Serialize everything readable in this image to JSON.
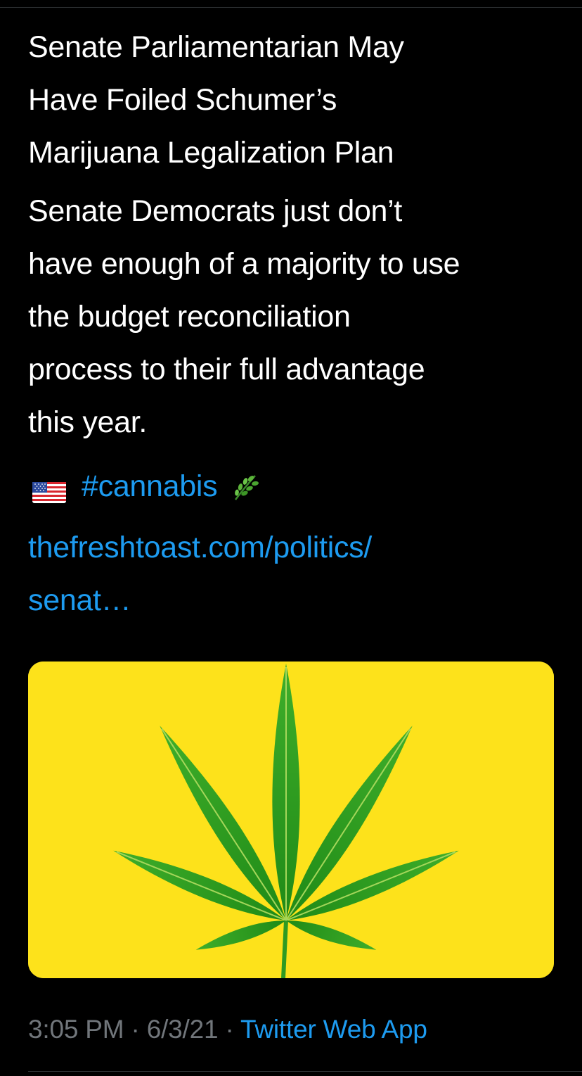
{
  "tweet": {
    "headline": "Senate Parliamentarian May\nHave Foiled Schumer’s\nMarijuana Legalization Plan",
    "body": "Senate Democrats just don’t\nhave enough of a majority to use\nthe budget reconciliation\nprocess to their full advantage\nthis year.",
    "flag_icon": "us-flag-icon",
    "hashtag": "#cannabis",
    "leaf_icon": "herb-icon",
    "link": "thefreshtoast.com/politics/\nsenat…"
  },
  "media": {
    "image_subject": "cannabis-leaf-image",
    "background_color": "#fde21b",
    "leaf_color": "#2e9e1e"
  },
  "meta": {
    "time": "3:05 PM",
    "separator": "·",
    "date": "6/3/21",
    "source": "Twitter Web App"
  },
  "colors": {
    "background": "#000000",
    "text": "#ffffff",
    "link": "#1d9bf0",
    "muted": "#71767b",
    "divider": "#2f3336"
  }
}
